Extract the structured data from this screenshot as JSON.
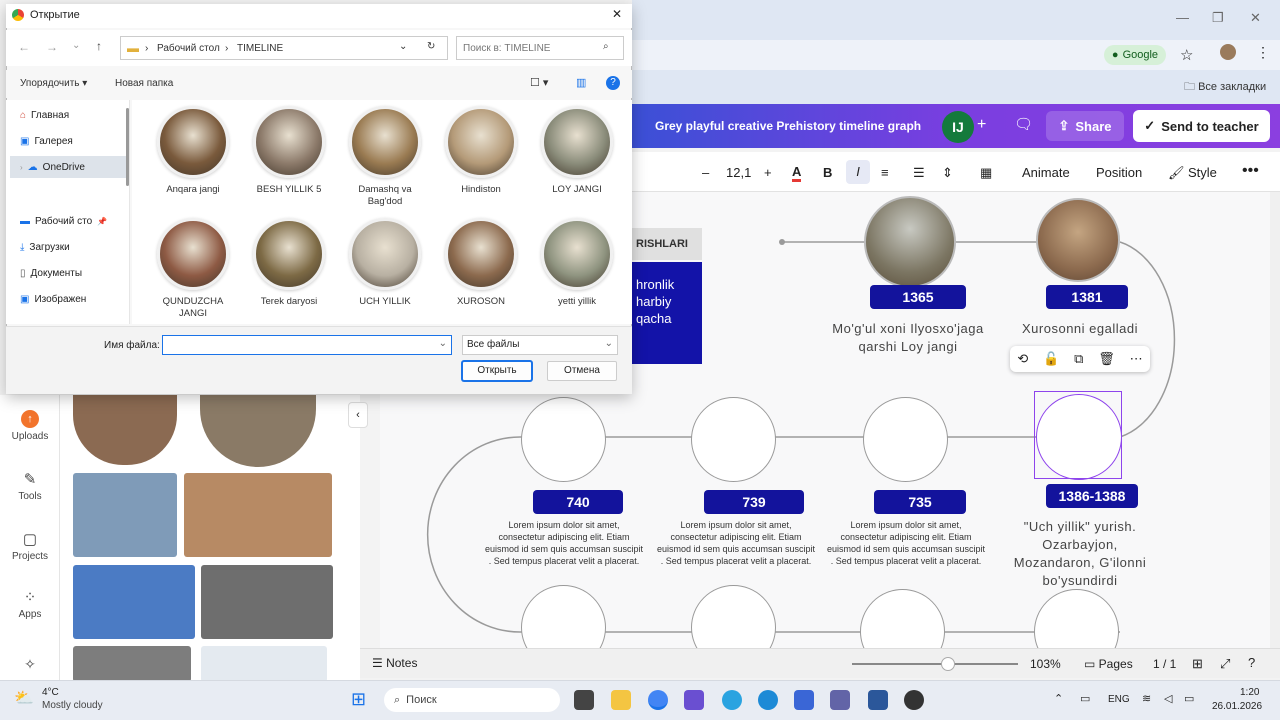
{
  "dialog": {
    "title": "Открытие",
    "path": [
      "Рабочий стол",
      "TIMELINE"
    ],
    "search_placeholder": "Поиск в: TIMELINE",
    "organize": "Упорядочить",
    "new_folder": "Новая папка",
    "sidebar": [
      {
        "label": "Главная",
        "icon": "home-icon"
      },
      {
        "label": "Галерея",
        "icon": "gallery-icon"
      },
      {
        "label": "OneDrive",
        "icon": "cloud-icon"
      },
      {
        "label": "Рабочий сто",
        "icon": "desktop-icon"
      },
      {
        "label": "Загрузки",
        "icon": "download-icon"
      },
      {
        "label": "Документы",
        "icon": "document-icon"
      },
      {
        "label": "Изображен",
        "icon": "picture-icon"
      }
    ],
    "files": [
      {
        "name": "Anqara jangi",
        "color": "#7a5a3c"
      },
      {
        "name": "BESH YILLIK 5",
        "color": "#8c7a6a"
      },
      {
        "name": "Damashq va Bag'dod",
        "color": "#9a7b52"
      },
      {
        "name": "Hindiston",
        "color": "#b49a78"
      },
      {
        "name": "LOY JANGI",
        "color": "#8a8c7a"
      },
      {
        "name": "QUNDUZCHA JANGI",
        "color": "#8e5a44"
      },
      {
        "name": "Terek daryosi",
        "color": "#7d6a45"
      },
      {
        "name": "UCH YILLIK",
        "color": "#b8b0a2"
      },
      {
        "name": "XUROSON",
        "color": "#8c6a4e"
      },
      {
        "name": "yetti yillik",
        "color": "#8f9480"
      }
    ],
    "filename_label": "Имя файла:",
    "filename_value": "",
    "filetype": "Все файлы",
    "open_button": "Открыть",
    "cancel_button": "Отмена"
  },
  "browser": {
    "google_button": "Google",
    "bookmarks": "Все закладки"
  },
  "canva": {
    "title": "Grey playful creative Prehistory timeline graph",
    "avatar": "IJ",
    "share": "Share",
    "send": "Send to teacher",
    "font_size": "12,1",
    "animate": "Animate",
    "position": "Position",
    "style": "Style",
    "rail": [
      {
        "label": "Uploads",
        "icon": "upload-icon"
      },
      {
        "label": "Tools",
        "icon": "tools-icon"
      },
      {
        "label": "Projects",
        "icon": "folder-icon"
      },
      {
        "label": "Apps",
        "icon": "apps-icon"
      }
    ],
    "partial_header": "RISHLARI",
    "partial_box": [
      "hronlik",
      "harbiy",
      "qacha"
    ],
    "years_top": [
      "1365",
      "1381"
    ],
    "captions_top": [
      "Mo'g'ul xoni Ilyosxo'jaga qarshi Loy jangi",
      "Xurosonni egalladi"
    ],
    "years_mid": [
      "740",
      "739",
      "735",
      "1386-1388"
    ],
    "lorem": "Lorem ipsum dolor sit amet, consectetur adipiscing elit. Etiam euismod id sem quis accumsan suscipit . Sed tempus placerat velit a placerat.",
    "caption_selected": "\"Uch yillik\" yurish. Ozarbayjon, Mozandaron, G'ilonni bo'ysundirdi",
    "notes": "Notes",
    "zoom": "103%",
    "pages": "Pages",
    "page_count": "1 / 1"
  },
  "taskbar": {
    "weather_temp": "4°C",
    "weather_desc": "Mostly cloudy",
    "search": "Поиск",
    "lang": "ENG",
    "time": "1:20",
    "date": "26.01.2026"
  }
}
